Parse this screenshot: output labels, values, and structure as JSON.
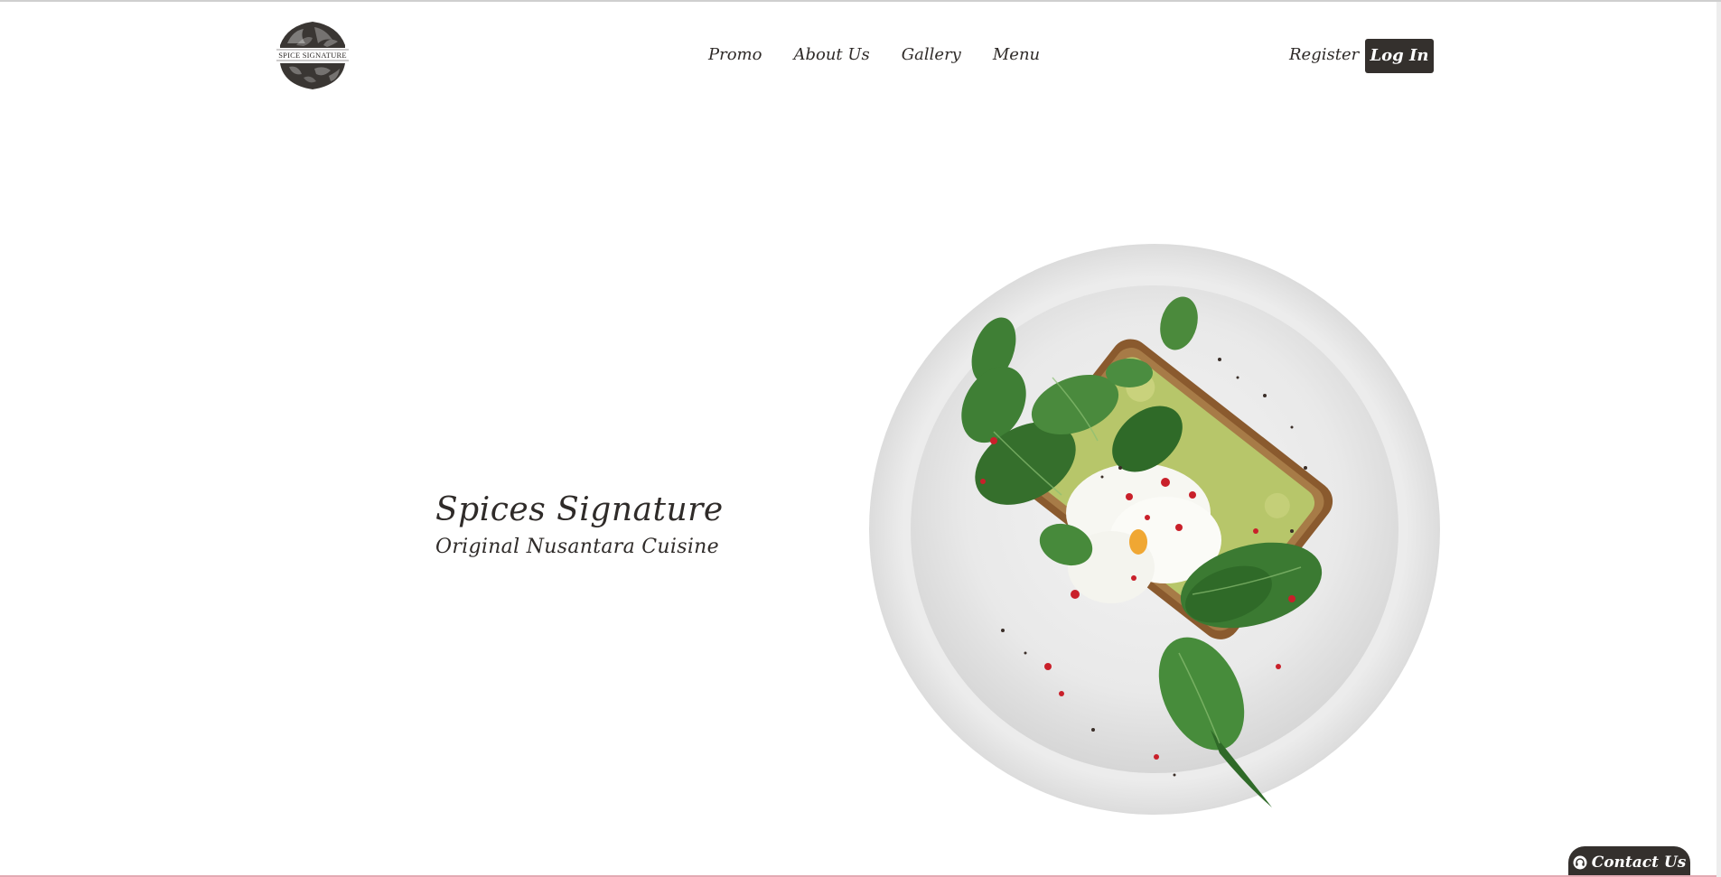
{
  "brand": {
    "logo_text": "SPICE SIGNATURE"
  },
  "nav": {
    "items": [
      {
        "label": "Promo"
      },
      {
        "label": "About Us"
      },
      {
        "label": "Gallery"
      },
      {
        "label": "Menu"
      }
    ]
  },
  "auth": {
    "register_label": "Register",
    "login_label": "Log In"
  },
  "hero": {
    "title": "Spices Signature",
    "subtitle": "Original Nusantara Cuisine",
    "image": "plate-avocado-toast-poached-egg-spinach"
  },
  "contact": {
    "label": "Contact Us",
    "icon": "headset-icon"
  },
  "colors": {
    "dark": "#34302d",
    "text": "#2f2b29",
    "background": "#ffffff"
  }
}
